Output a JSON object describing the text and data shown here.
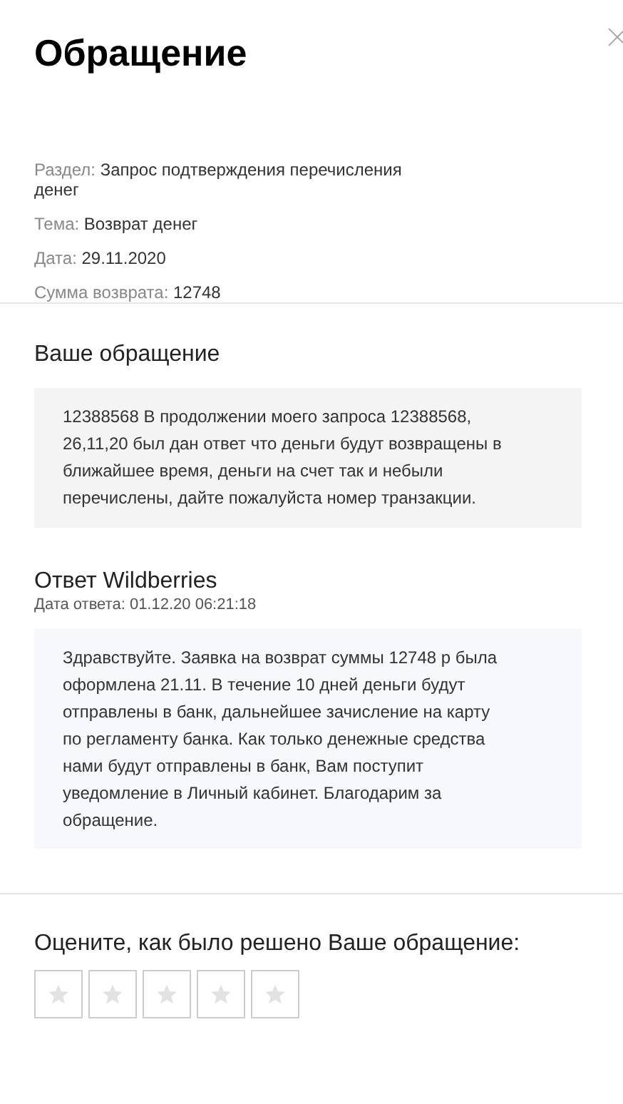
{
  "title": "Обращение",
  "details": [
    {
      "label": "Раздел:",
      "value": "Запрос подтверждения перечисления денег"
    },
    {
      "label": "Тема:",
      "value": "Возврат денег"
    },
    {
      "label": "Дата:",
      "value": "29.11.2020"
    },
    {
      "label": "Сумма возврата:",
      "value": "12748"
    }
  ],
  "request": {
    "heading": "Ваше обращение",
    "text": "12388568 В продолжении моего запроса 12388568, 26,11,20 был дан ответ что деньги будут возвращены в ближайшее время, деньги на счет так и небыли перечислены, дайте пожалуйста номер транзакции."
  },
  "answer": {
    "heading": "Ответ Wildberries",
    "date": "Дата ответа: 01.12.20 06:21:18",
    "text": "Здравствуйте. Заявка на возврат суммы 12748 р была оформлена 21.11. В течение 10 дней деньги будут отправлены в банк, дальнейшее зачисление на карту по регламенту банка. Как только денежные средства нами будут отправлены в банк, Вам поступит уведомление в Личный кабинет. Благодарим за обращение."
  },
  "rating": {
    "prompt": "Оцените, как было решено Ваше обращение:",
    "stars": 0
  }
}
